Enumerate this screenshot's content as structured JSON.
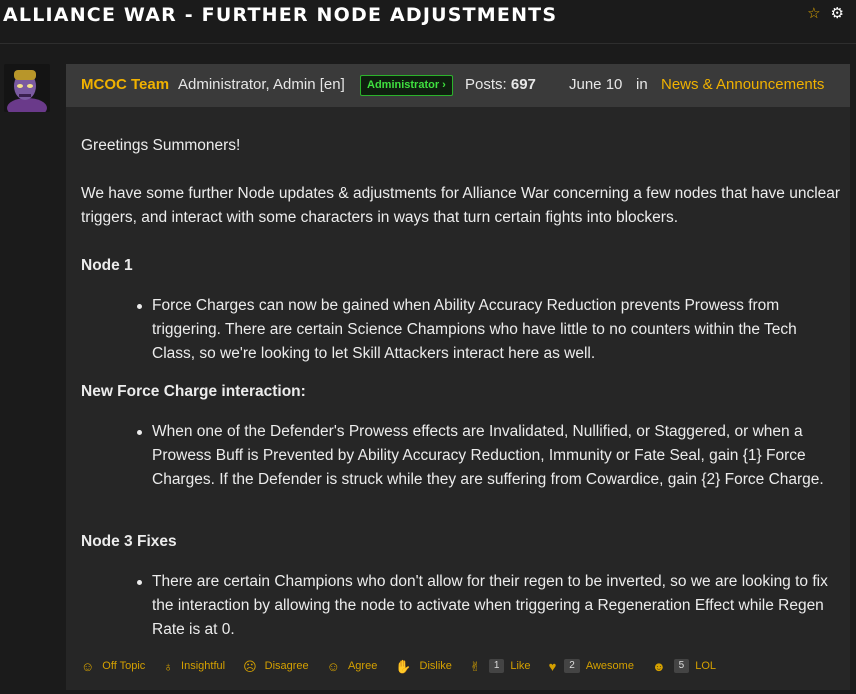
{
  "thread": {
    "title": "ALLIANCE WAR - FURTHER NODE ADJUSTMENTS",
    "icons": [
      "star-icon",
      "gear-icon"
    ]
  },
  "post": {
    "author": "MCOC Team",
    "roles": "Administrator, Admin [en]",
    "badge": "Administrator ›",
    "posts_label": "Posts:",
    "posts_count": "697",
    "date": "June 10",
    "in": "in",
    "category": "News & Announcements",
    "paragraphs": {
      "greeting": "Greetings Summoners!",
      "intro": "We have some further Node updates & adjustments for Alliance War concerning a few nodes that have unclear triggers, and interact with some characters in ways that turn certain fights into blockers.",
      "node1_heading": "Node 1",
      "node1_item": "Force Charges can now be gained when Ability Accuracy Reduction prevents Prowess from triggering. There are certain Science Champions who have little to no counters within the Tech Class, so we're looking to let Skill Attackers interact here as well.",
      "force_heading": "New Force Charge interaction:",
      "force_item": "When one of the Defender's Prowess effects are Invalidated, Nullified, or Staggered, or when a Prowess Buff is Prevented by Ability Accuracy Reduction, Immunity or Fate Seal, gain {1} Force Charges. If the Defender is struck while they are suffering from Cowardice, gain {2} Force Charge.",
      "node3_heading": "Node 3 Fixes",
      "node3_item": "There are certain Champions who don't allow for their regen to be inverted, so we are looking to fix the interaction by allowing the node to activate when triggering a Regeneration Effect while Regen Rate is at 0."
    },
    "reactions": {
      "off_topic": "Off Topic",
      "insightful": "Insightful",
      "disagree": "Disagree",
      "agree": "Agree",
      "dislike": "Dislike",
      "like_count": "1",
      "like": "Like",
      "awesome_count": "2",
      "awesome": "Awesome",
      "lol_count": "5",
      "lol": "LOL"
    }
  },
  "colors": {
    "accent": "#f0b100",
    "badge_green": "#3fe03f",
    "background": "#1b1b1b",
    "post_bg": "#262626",
    "header_bg": "#3a3a3a"
  }
}
